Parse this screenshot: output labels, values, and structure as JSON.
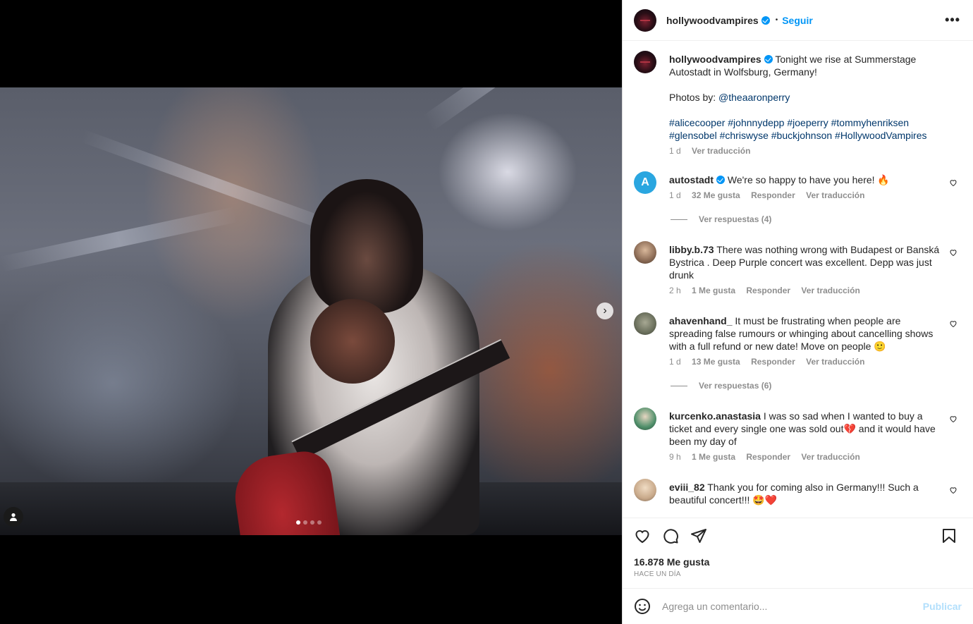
{
  "post": {
    "username": "hollywoodvampires",
    "follow_label": "Seguir",
    "separator": "•",
    "more_label": "•••",
    "carousel": {
      "total": 4,
      "active": 0
    },
    "caption": {
      "text": "Tonight we rise at Summerstage Autostadt in Wolfsburg, Germany!",
      "photos_prefix": "Photos by: ",
      "photos_credit": "@theaaronperry",
      "hashtags": "#alicecooper #johnnydepp #joeperry #tommyhenriksen #glensobel #chriswyse #buckjohnson #HollywoodVampires",
      "time": "1 d",
      "translate": "Ver traducción"
    }
  },
  "comments": [
    {
      "username": "autostadt",
      "verified": true,
      "text": "We're so happy to have you here! 🔥",
      "time": "1 d",
      "likes": "32 Me gusta",
      "reply": "Responder",
      "translate": "Ver traducción",
      "replies": "Ver respuestas (4)",
      "avatar_color": "#2aa6e0"
    },
    {
      "username": "libby.b.73",
      "text": "There was nothing wrong with Budapest or Banská Bystrica . Deep Purple concert was excellent. Depp was just drunk",
      "time": "2 h",
      "likes": "1 Me gusta",
      "reply": "Responder",
      "translate": "Ver traducción",
      "avatar_color": "#8b6b55"
    },
    {
      "username": "ahavenhand_",
      "text": "It must be frustrating when people are spreading false rumours or whinging about cancelling shows with a full refund or new date! Move on people 🙂",
      "time": "1 d",
      "likes": "13 Me gusta",
      "reply": "Responder",
      "translate": "Ver traducción",
      "replies": "Ver respuestas (6)",
      "avatar_color": "#6a6f5c"
    },
    {
      "username": "kurcenko.anastasia",
      "text": "I was so sad when I wanted to buy a ticket and every single one was sold out💔 and it would have been my day of",
      "time": "9 h",
      "likes": "1 Me gusta",
      "reply": "Responder",
      "translate": "Ver traducción",
      "avatar_color": "#4f8f6a"
    },
    {
      "username": "eviii_82",
      "text": "Thank you for coming also in Germany!!! Such a beautiful concert!!! 🤩❤️",
      "avatar_color": "#c8a98a"
    }
  ],
  "actions": {
    "likes": "16.878 Me gusta",
    "time_ago": "Hace un día"
  },
  "add_comment": {
    "placeholder": "Agrega un comentario...",
    "post_label": "Publicar"
  },
  "icons": [
    "heart-icon",
    "comment-icon",
    "share-icon",
    "bookmark-icon",
    "emoji-icon",
    "verified-icon",
    "chevron-right-icon",
    "tagged-user-icon"
  ]
}
